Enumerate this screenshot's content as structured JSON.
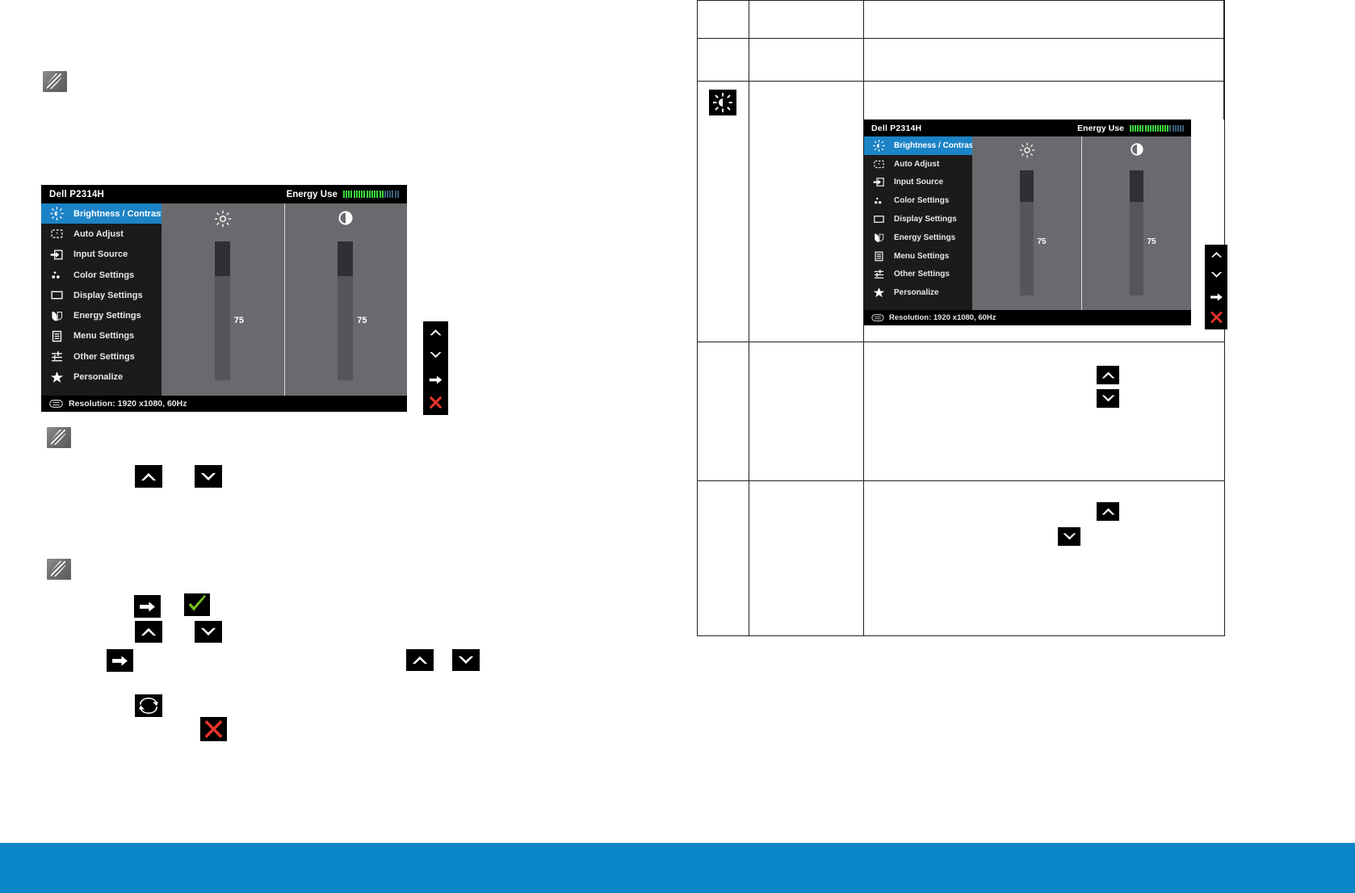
{
  "page": {
    "background": "#ffffff",
    "accent_blue": "#0a85c8",
    "osd_highlight": "#1c83c6"
  },
  "osd": {
    "model": "Dell P2314H",
    "energy_label": "Energy Use",
    "energy_bars_total": 22,
    "energy_bars_lit": 16,
    "energy_color_lit": "#3ddc3d",
    "energy_color_dim": "#3a5f7a",
    "menu_items": [
      {
        "icon": "brightness-contrast-icon",
        "label": "Brightness / Contrast",
        "selected": true
      },
      {
        "icon": "auto-adjust-icon",
        "label": "Auto Adjust",
        "selected": false
      },
      {
        "icon": "input-source-icon",
        "label": "Input Source",
        "selected": false
      },
      {
        "icon": "color-settings-icon",
        "label": "Color Settings",
        "selected": false
      },
      {
        "icon": "display-settings-icon",
        "label": "Display Settings",
        "selected": false
      },
      {
        "icon": "energy-settings-icon",
        "label": "Energy Settings",
        "selected": false
      },
      {
        "icon": "menu-settings-icon",
        "label": "Menu Settings",
        "selected": false
      },
      {
        "icon": "other-settings-icon",
        "label": "Other Settings",
        "selected": false
      },
      {
        "icon": "personalize-icon",
        "label": "Personalize",
        "selected": false
      }
    ],
    "brightness_value": "75",
    "contrast_value": "75",
    "brightness_percent": 75,
    "contrast_percent": 75,
    "footer_text": "Resolution: 1920 x1080, 60Hz",
    "nav_buttons": [
      {
        "icon": "chevron-up-icon",
        "color": "#ffffff"
      },
      {
        "icon": "chevron-down-icon",
        "color": "#ffffff"
      },
      {
        "icon": "arrow-right-icon",
        "color": "#ffffff"
      },
      {
        "icon": "close-x-icon",
        "color": "#e8352a"
      }
    ]
  },
  "left_column": {
    "note_icons": [
      "note-icon",
      "note-icon",
      "note-icon"
    ],
    "inline_icons": [
      {
        "name": "chevron-up-icon",
        "color": "#ffffff"
      },
      {
        "name": "chevron-down-icon",
        "color": "#ffffff"
      },
      {
        "name": "arrow-right-icon",
        "color": "#ffffff"
      },
      {
        "name": "check-icon",
        "color": "#76c11a"
      },
      {
        "name": "chevron-up-icon",
        "color": "#ffffff"
      },
      {
        "name": "chevron-down-icon",
        "color": "#ffffff"
      },
      {
        "name": "arrow-right-icon",
        "color": "#ffffff"
      },
      {
        "name": "chevron-up-icon",
        "color": "#ffffff"
      },
      {
        "name": "chevron-down-icon",
        "color": "#ffffff"
      },
      {
        "name": "reset-icon",
        "color": "#ffffff"
      },
      {
        "name": "close-x-icon",
        "color": "#e8352a"
      }
    ]
  },
  "table": {
    "rows": [
      {
        "icon": "",
        "name": "",
        "content": ""
      },
      {
        "icon": "",
        "name": "",
        "content": ""
      },
      {
        "icon": "brightness-contrast-icon",
        "name": "",
        "content": "osd-screenshot"
      },
      {
        "icon": "",
        "name": "",
        "content": "up-down-icons"
      },
      {
        "icon": "",
        "name": "",
        "content": "up-down-icons-offset"
      }
    ]
  }
}
